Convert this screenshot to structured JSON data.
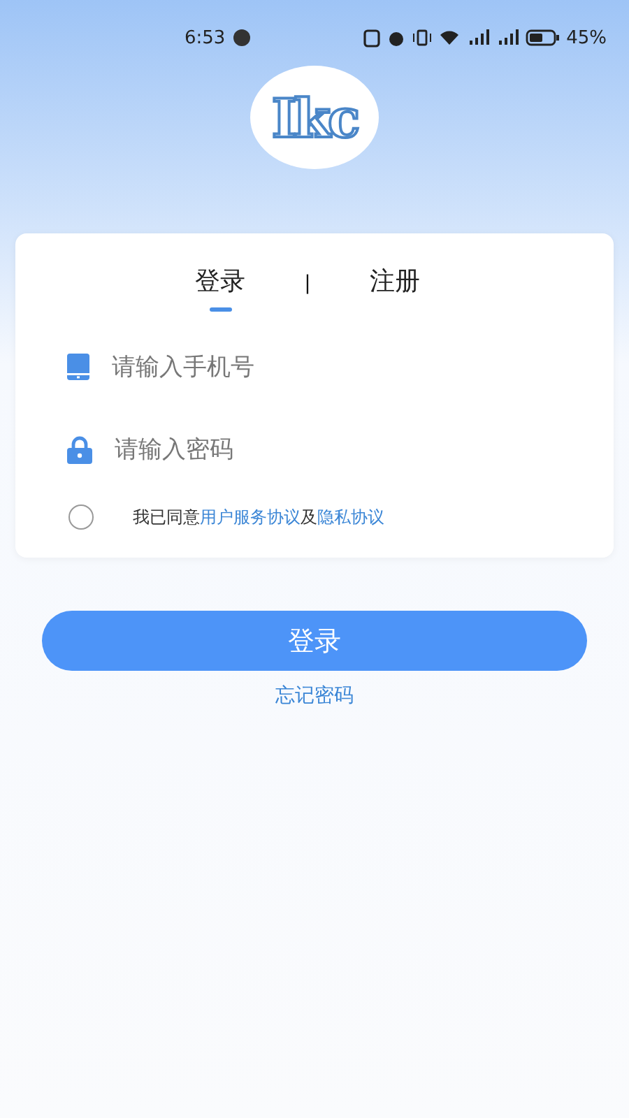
{
  "status_bar": {
    "time": "6:53",
    "battery": "45%"
  },
  "logo": {
    "text": "Ikc"
  },
  "tabs": [
    {
      "label": "登录",
      "selected": true
    },
    {
      "label": "注册",
      "selected": false
    }
  ],
  "tab_separator": "|",
  "fields": [
    {
      "kind": "phone",
      "placeholder": "请输入手机号"
    },
    {
      "kind": "password",
      "placeholder": "请输入密码"
    }
  ],
  "agreement": {
    "checked": false,
    "prefix": "我已同意",
    "link1": "用户服务协议",
    "middle": "及",
    "link2": "隐私协议"
  },
  "login_button": "登录",
  "forgot_link": "忘记密码"
}
